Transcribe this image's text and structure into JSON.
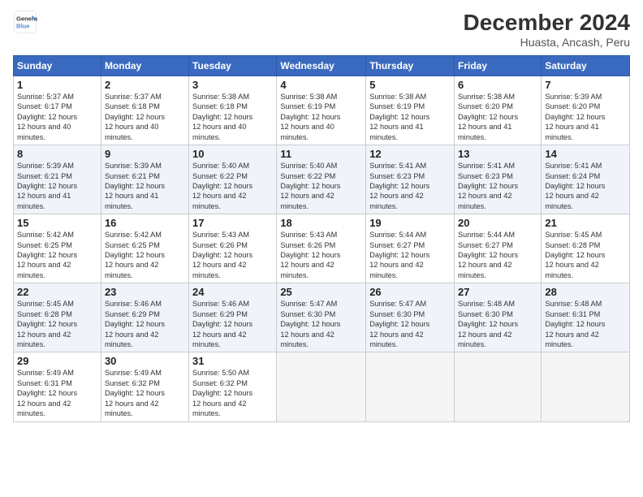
{
  "logo": {
    "line1": "General",
    "line2": "Blue"
  },
  "title": "December 2024",
  "subtitle": "Huasta, Ancash, Peru",
  "days_of_week": [
    "Sunday",
    "Monday",
    "Tuesday",
    "Wednesday",
    "Thursday",
    "Friday",
    "Saturday"
  ],
  "weeks": [
    [
      {
        "day": "1",
        "rise": "5:37 AM",
        "set": "6:17 PM",
        "hours": "12 hours and 40 minutes."
      },
      {
        "day": "2",
        "rise": "5:37 AM",
        "set": "6:18 PM",
        "hours": "12 hours and 40 minutes."
      },
      {
        "day": "3",
        "rise": "5:38 AM",
        "set": "6:18 PM",
        "hours": "12 hours and 40 minutes."
      },
      {
        "day": "4",
        "rise": "5:38 AM",
        "set": "6:19 PM",
        "hours": "12 hours and 40 minutes."
      },
      {
        "day": "5",
        "rise": "5:38 AM",
        "set": "6:19 PM",
        "hours": "12 hours and 41 minutes."
      },
      {
        "day": "6",
        "rise": "5:38 AM",
        "set": "6:20 PM",
        "hours": "12 hours and 41 minutes."
      },
      {
        "day": "7",
        "rise": "5:39 AM",
        "set": "6:20 PM",
        "hours": "12 hours and 41 minutes."
      }
    ],
    [
      {
        "day": "8",
        "rise": "5:39 AM",
        "set": "6:21 PM",
        "hours": "12 hours and 41 minutes."
      },
      {
        "day": "9",
        "rise": "5:39 AM",
        "set": "6:21 PM",
        "hours": "12 hours and 41 minutes."
      },
      {
        "day": "10",
        "rise": "5:40 AM",
        "set": "6:22 PM",
        "hours": "12 hours and 42 minutes."
      },
      {
        "day": "11",
        "rise": "5:40 AM",
        "set": "6:22 PM",
        "hours": "12 hours and 42 minutes."
      },
      {
        "day": "12",
        "rise": "5:41 AM",
        "set": "6:23 PM",
        "hours": "12 hours and 42 minutes."
      },
      {
        "day": "13",
        "rise": "5:41 AM",
        "set": "6:23 PM",
        "hours": "12 hours and 42 minutes."
      },
      {
        "day": "14",
        "rise": "5:41 AM",
        "set": "6:24 PM",
        "hours": "12 hours and 42 minutes."
      }
    ],
    [
      {
        "day": "15",
        "rise": "5:42 AM",
        "set": "6:25 PM",
        "hours": "12 hours and 42 minutes."
      },
      {
        "day": "16",
        "rise": "5:42 AM",
        "set": "6:25 PM",
        "hours": "12 hours and 42 minutes."
      },
      {
        "day": "17",
        "rise": "5:43 AM",
        "set": "6:26 PM",
        "hours": "12 hours and 42 minutes."
      },
      {
        "day": "18",
        "rise": "5:43 AM",
        "set": "6:26 PM",
        "hours": "12 hours and 42 minutes."
      },
      {
        "day": "19",
        "rise": "5:44 AM",
        "set": "6:27 PM",
        "hours": "12 hours and 42 minutes."
      },
      {
        "day": "20",
        "rise": "5:44 AM",
        "set": "6:27 PM",
        "hours": "12 hours and 42 minutes."
      },
      {
        "day": "21",
        "rise": "5:45 AM",
        "set": "6:28 PM",
        "hours": "12 hours and 42 minutes."
      }
    ],
    [
      {
        "day": "22",
        "rise": "5:45 AM",
        "set": "6:28 PM",
        "hours": "12 hours and 42 minutes."
      },
      {
        "day": "23",
        "rise": "5:46 AM",
        "set": "6:29 PM",
        "hours": "12 hours and 42 minutes."
      },
      {
        "day": "24",
        "rise": "5:46 AM",
        "set": "6:29 PM",
        "hours": "12 hours and 42 minutes."
      },
      {
        "day": "25",
        "rise": "5:47 AM",
        "set": "6:30 PM",
        "hours": "12 hours and 42 minutes."
      },
      {
        "day": "26",
        "rise": "5:47 AM",
        "set": "6:30 PM",
        "hours": "12 hours and 42 minutes."
      },
      {
        "day": "27",
        "rise": "5:48 AM",
        "set": "6:30 PM",
        "hours": "12 hours and 42 minutes."
      },
      {
        "day": "28",
        "rise": "5:48 AM",
        "set": "6:31 PM",
        "hours": "12 hours and 42 minutes."
      }
    ],
    [
      {
        "day": "29",
        "rise": "5:49 AM",
        "set": "6:31 PM",
        "hours": "12 hours and 42 minutes."
      },
      {
        "day": "30",
        "rise": "5:49 AM",
        "set": "6:32 PM",
        "hours": "12 hours and 42 minutes."
      },
      {
        "day": "31",
        "rise": "5:50 AM",
        "set": "6:32 PM",
        "hours": "12 hours and 42 minutes."
      },
      null,
      null,
      null,
      null
    ]
  ],
  "labels": {
    "sunrise": "Sunrise:",
    "sunset": "Sunset:",
    "daylight": "Daylight:"
  }
}
